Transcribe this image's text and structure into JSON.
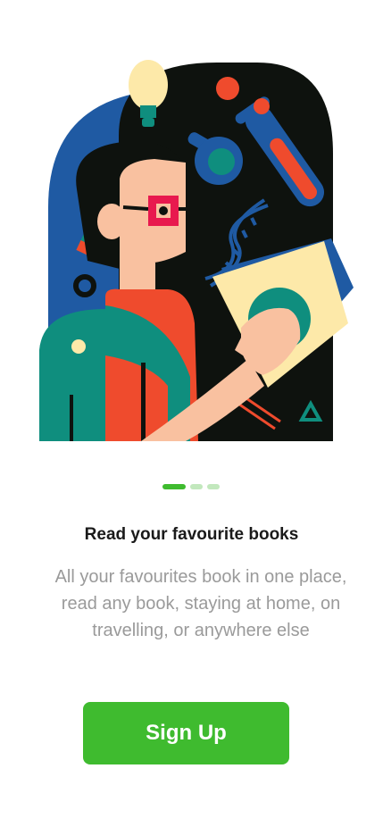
{
  "onboarding": {
    "title": "Read your favourite books",
    "description": "All your favourites book in one place, read any book, staying at home, on travelling, or anywhere else",
    "signup_label": "Sign Up",
    "page_indicator": {
      "current": 1,
      "total": 3
    }
  },
  "colors": {
    "accent": "#3fbb2f",
    "indicator_idle": "#c2e8bd",
    "title": "#1a1a1a",
    "description": "#9a9a9a"
  },
  "icons": [
    "illustration-person-reading",
    "lightbulb-icon",
    "flask-icon",
    "test-tube-icon",
    "dna-icon",
    "pencil-icon",
    "book-icon"
  ]
}
